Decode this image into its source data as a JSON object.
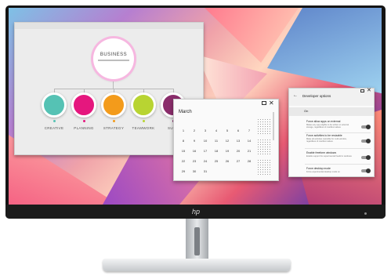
{
  "slide": {
    "hub_title": "BUSINESS",
    "nodes": [
      {
        "label": "CREATIVE",
        "color": "#55c2b4"
      },
      {
        "label": "PLANNING",
        "color": "#e5177e"
      },
      {
        "label": "STRATEGY",
        "color": "#f39b1b"
      },
      {
        "label": "TEAMWORK",
        "color": "#b8d432"
      },
      {
        "label": "SUCC",
        "color": "#8a2d6b"
      }
    ]
  },
  "calendar": {
    "month": "March",
    "weekdays": [
      "",
      "",
      "",
      "",
      "",
      "",
      ""
    ],
    "rows": [
      [
        "1",
        "2",
        "3",
        "4",
        "5",
        "6",
        "7"
      ],
      [
        "8",
        "9",
        "10",
        "11",
        "12",
        "13",
        "14"
      ],
      [
        "15",
        "16",
        "17",
        "18",
        "19",
        "20",
        "21"
      ],
      [
        "22",
        "23",
        "24",
        "25",
        "26",
        "27",
        "28"
      ],
      [
        "29",
        "30",
        "31",
        "",
        "",
        "",
        ""
      ]
    ]
  },
  "developer": {
    "back": "←",
    "title": "Developer options",
    "on_label": "On",
    "options": [
      {
        "title": "Force allow apps on external",
        "desc": "Makes any app eligible to be written to external storage, regardless of manifest values"
      },
      {
        "title": "Force activities to be resizable",
        "desc": "Make all activities resizable for multi-window, regardless of manifest values"
      },
      {
        "title": "Enable freeform windows",
        "desc": "Enable support for experimental freeform windows"
      },
      {
        "title": "Force desktop mode",
        "desc": "Force experimental desktop mode on"
      }
    ]
  },
  "monitor": {
    "logo": "hp"
  }
}
